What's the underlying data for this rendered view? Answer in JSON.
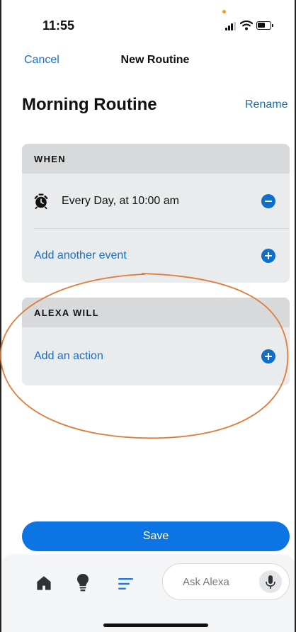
{
  "status_bar": {
    "time": "11:55"
  },
  "nav": {
    "cancel_label": "Cancel",
    "title": "New Routine"
  },
  "routine": {
    "name": "Morning Routine",
    "rename_label": "Rename"
  },
  "when_section": {
    "header": "WHEN",
    "event": {
      "label": "Every Day, at 10:00 am",
      "icon": "alarm-clock-icon"
    },
    "add_event_label": "Add another event"
  },
  "alexa_section": {
    "header": "ALEXA WILL",
    "add_action_label": "Add an action"
  },
  "save_label": "Save",
  "bottom_nav": {
    "icons": [
      "home-icon",
      "lightbulb-icon",
      "routines-icon"
    ],
    "ask_alexa_placeholder": "Ask Alexa",
    "mic_icon": "microphone-icon"
  },
  "colors": {
    "accent": "#0d74e3",
    "link": "#1b6ec2",
    "annotation": "#e07b39",
    "card": "#e9ebec",
    "card_header": "#d7d9db"
  }
}
